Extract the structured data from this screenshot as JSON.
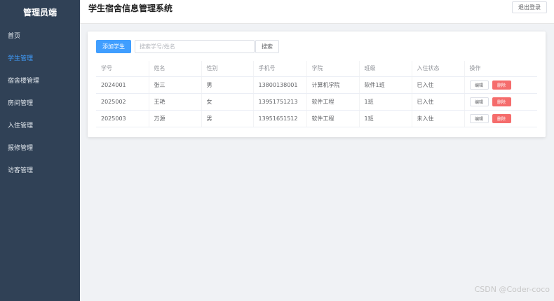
{
  "sidebar": {
    "title": "管理员端",
    "items": [
      {
        "label": "首页"
      },
      {
        "label": "学生管理"
      },
      {
        "label": "宿舍楼管理"
      },
      {
        "label": "房间管理"
      },
      {
        "label": "入住管理"
      },
      {
        "label": "报修管理"
      },
      {
        "label": "访客管理"
      }
    ],
    "active_index": 1
  },
  "header": {
    "title": "学生宿舍信息管理系统",
    "logout_label": "退出登录"
  },
  "toolbar": {
    "add_label": "添加学生",
    "search_placeholder": "搜索学号/姓名",
    "search_label": "搜索"
  },
  "table": {
    "columns": [
      "学号",
      "姓名",
      "性别",
      "手机号",
      "学院",
      "班级",
      "入住状态",
      "操作"
    ],
    "rows": [
      [
        "2024001",
        "张三",
        "男",
        "13800138001",
        "计算机学院",
        "软件1班",
        "已入住"
      ],
      [
        "2025002",
        "王艳",
        "女",
        "13951751213",
        "软件工程",
        "1班",
        "已入住"
      ],
      [
        "2025003",
        "万源",
        "男",
        "13951651512",
        "软件工程",
        "1班",
        "未入住"
      ]
    ],
    "edit_label": "编辑",
    "delete_label": "删除"
  },
  "watermark": "CSDN @Coder-coco",
  "colors": {
    "sidebar_bg": "#304156",
    "accent": "#409eff",
    "danger": "#f56c6c",
    "page_bg": "#f0f2f5"
  }
}
